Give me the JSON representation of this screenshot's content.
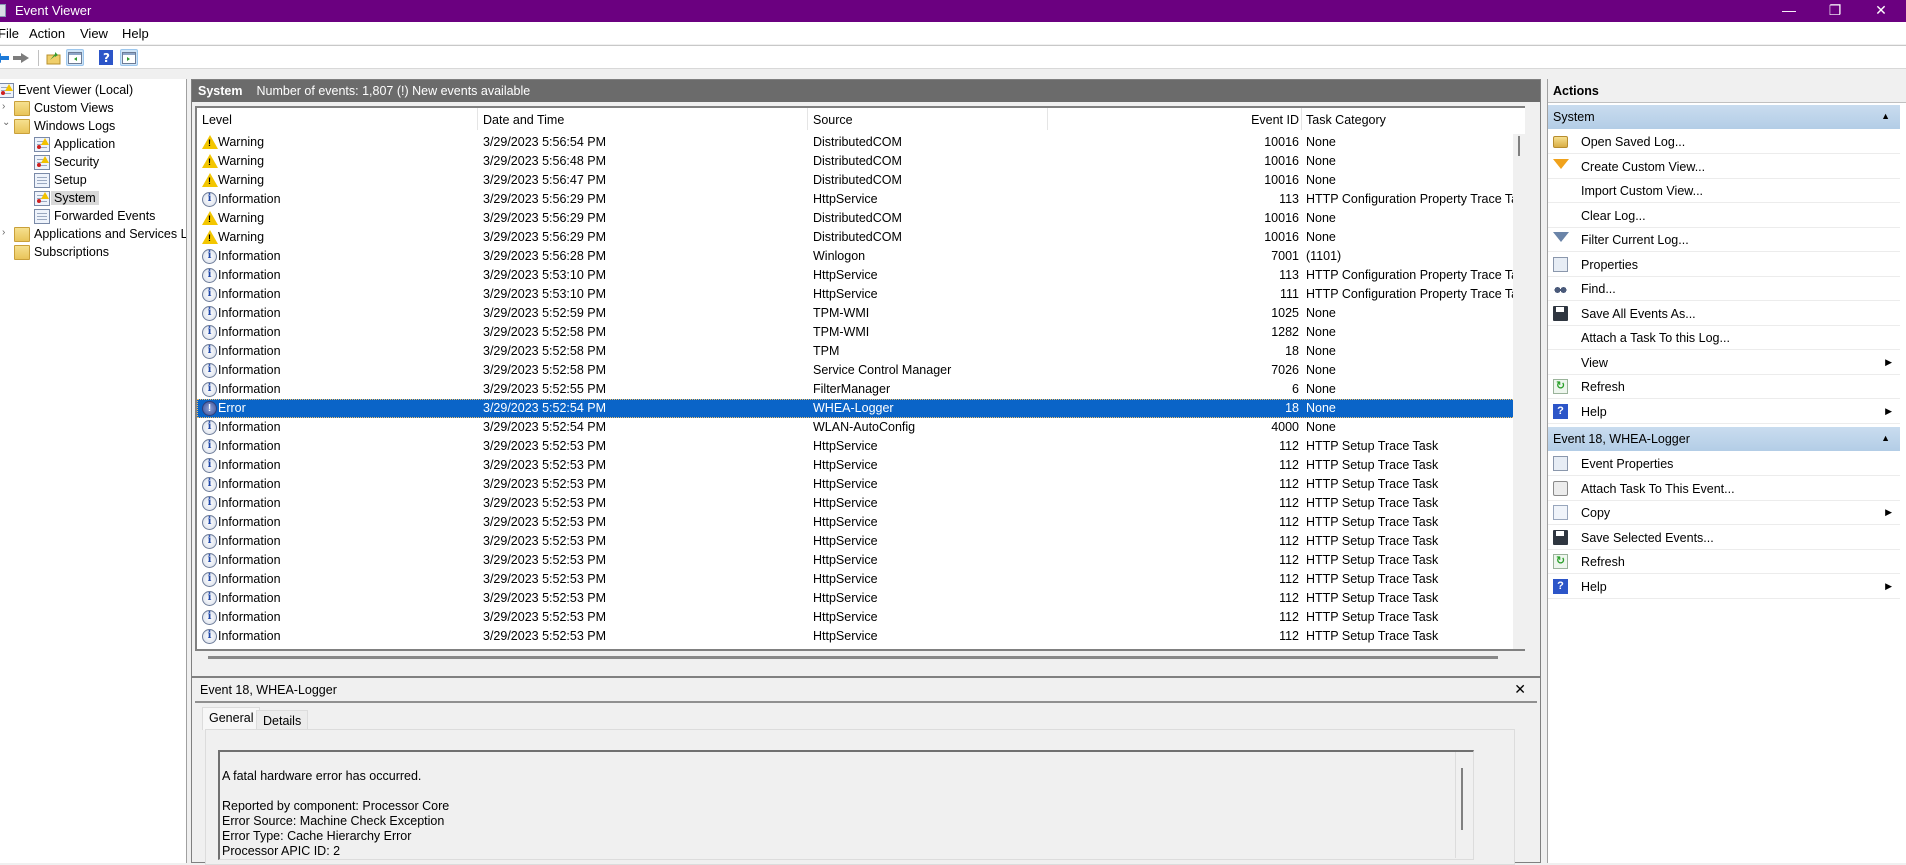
{
  "window": {
    "title": "Event Viewer",
    "controls": {
      "minimize": "—",
      "restore": "❐",
      "close": "✕"
    }
  },
  "menu": [
    "File",
    "Action",
    "View",
    "Help"
  ],
  "toolbar": [
    {
      "icon": "back-arrow-icon"
    },
    {
      "icon": "forward-arrow-icon"
    },
    {
      "icon": "up-folder-icon"
    },
    {
      "icon": "show-hide-console-tree-icon"
    },
    {
      "icon": "help-icon",
      "glyph": "?"
    },
    {
      "icon": "show-hide-action-pane-icon"
    }
  ],
  "tree": {
    "root": "Event Viewer (Local)",
    "items": [
      {
        "label": "Custom Views",
        "level": 1,
        "expander": "›"
      },
      {
        "label": "Windows Logs",
        "level": 1,
        "expander": "⌄"
      },
      {
        "label": "Application",
        "level": 2
      },
      {
        "label": "Security",
        "level": 2
      },
      {
        "label": "Setup",
        "level": 2
      },
      {
        "label": "System",
        "level": 2,
        "selected": true
      },
      {
        "label": "Forwarded Events",
        "level": 2
      },
      {
        "label": "Applications and Services Lo",
        "level": 1,
        "expander": "›"
      },
      {
        "label": "Subscriptions",
        "level": 1
      }
    ]
  },
  "center": {
    "log_name": "System",
    "summary": "Number of events: 1,807 (!) New events available",
    "columns": [
      "Level",
      "Date and Time",
      "Source",
      "Event ID",
      "Task Category"
    ],
    "rows": [
      {
        "level": "Warning",
        "datetime": "3/29/2023 5:56:54 PM",
        "source": "DistributedCOM",
        "event_id": "10016",
        "task": "None"
      },
      {
        "level": "Warning",
        "datetime": "3/29/2023 5:56:48 PM",
        "source": "DistributedCOM",
        "event_id": "10016",
        "task": "None"
      },
      {
        "level": "Warning",
        "datetime": "3/29/2023 5:56:47 PM",
        "source": "DistributedCOM",
        "event_id": "10016",
        "task": "None"
      },
      {
        "level": "Information",
        "datetime": "3/29/2023 5:56:29 PM",
        "source": "HttpService",
        "event_id": "113",
        "task": "HTTP Configuration Property Trace Task"
      },
      {
        "level": "Warning",
        "datetime": "3/29/2023 5:56:29 PM",
        "source": "DistributedCOM",
        "event_id": "10016",
        "task": "None"
      },
      {
        "level": "Warning",
        "datetime": "3/29/2023 5:56:29 PM",
        "source": "DistributedCOM",
        "event_id": "10016",
        "task": "None"
      },
      {
        "level": "Information",
        "datetime": "3/29/2023 5:56:28 PM",
        "source": "Winlogon",
        "event_id": "7001",
        "task": "(1101)"
      },
      {
        "level": "Information",
        "datetime": "3/29/2023 5:53:10 PM",
        "source": "HttpService",
        "event_id": "113",
        "task": "HTTP Configuration Property Trace Task"
      },
      {
        "level": "Information",
        "datetime": "3/29/2023 5:53:10 PM",
        "source": "HttpService",
        "event_id": "111",
        "task": "HTTP Configuration Property Trace Task"
      },
      {
        "level": "Information",
        "datetime": "3/29/2023 5:52:59 PM",
        "source": "TPM-WMI",
        "event_id": "1025",
        "task": "None"
      },
      {
        "level": "Information",
        "datetime": "3/29/2023 5:52:58 PM",
        "source": "TPM-WMI",
        "event_id": "1282",
        "task": "None"
      },
      {
        "level": "Information",
        "datetime": "3/29/2023 5:52:58 PM",
        "source": "TPM",
        "event_id": "18",
        "task": "None"
      },
      {
        "level": "Information",
        "datetime": "3/29/2023 5:52:58 PM",
        "source": "Service Control Manager",
        "event_id": "7026",
        "task": "None"
      },
      {
        "level": "Information",
        "datetime": "3/29/2023 5:52:55 PM",
        "source": "FilterManager",
        "event_id": "6",
        "task": "None"
      },
      {
        "level": "Error",
        "datetime": "3/29/2023 5:52:54 PM",
        "source": "WHEA-Logger",
        "event_id": "18",
        "task": "None",
        "selected": true
      },
      {
        "level": "Information",
        "datetime": "3/29/2023 5:52:54 PM",
        "source": "WLAN-AutoConfig",
        "event_id": "4000",
        "task": "None"
      },
      {
        "level": "Information",
        "datetime": "3/29/2023 5:52:53 PM",
        "source": "HttpService",
        "event_id": "112",
        "task": "HTTP Setup Trace Task"
      },
      {
        "level": "Information",
        "datetime": "3/29/2023 5:52:53 PM",
        "source": "HttpService",
        "event_id": "112",
        "task": "HTTP Setup Trace Task"
      },
      {
        "level": "Information",
        "datetime": "3/29/2023 5:52:53 PM",
        "source": "HttpService",
        "event_id": "112",
        "task": "HTTP Setup Trace Task"
      },
      {
        "level": "Information",
        "datetime": "3/29/2023 5:52:53 PM",
        "source": "HttpService",
        "event_id": "112",
        "task": "HTTP Setup Trace Task"
      },
      {
        "level": "Information",
        "datetime": "3/29/2023 5:52:53 PM",
        "source": "HttpService",
        "event_id": "112",
        "task": "HTTP Setup Trace Task"
      },
      {
        "level": "Information",
        "datetime": "3/29/2023 5:52:53 PM",
        "source": "HttpService",
        "event_id": "112",
        "task": "HTTP Setup Trace Task"
      },
      {
        "level": "Information",
        "datetime": "3/29/2023 5:52:53 PM",
        "source": "HttpService",
        "event_id": "112",
        "task": "HTTP Setup Trace Task"
      },
      {
        "level": "Information",
        "datetime": "3/29/2023 5:52:53 PM",
        "source": "HttpService",
        "event_id": "112",
        "task": "HTTP Setup Trace Task"
      },
      {
        "level": "Information",
        "datetime": "3/29/2023 5:52:53 PM",
        "source": "HttpService",
        "event_id": "112",
        "task": "HTTP Setup Trace Task"
      },
      {
        "level": "Information",
        "datetime": "3/29/2023 5:52:53 PM",
        "source": "HttpService",
        "event_id": "112",
        "task": "HTTP Setup Trace Task"
      },
      {
        "level": "Information",
        "datetime": "3/29/2023 5:52:53 PM",
        "source": "HttpService",
        "event_id": "112",
        "task": "HTTP Setup Trace Task"
      }
    ]
  },
  "detail": {
    "title": "Event 18, WHEA-Logger",
    "close": "✕",
    "tabs": [
      "General",
      "Details"
    ],
    "active_tab": "General",
    "message": "A fatal hardware error has occurred.\n\nReported by component: Processor Core\nError Source: Machine Check Exception\nError Type: Cache Hierarchy Error\nProcessor APIC ID: 2"
  },
  "actions": {
    "title": "Actions",
    "sections": [
      {
        "header": "System",
        "items": [
          {
            "label": "Open Saved Log...",
            "icon": "open-folder-icon"
          },
          {
            "label": "Create Custom View...",
            "icon": "funnel-icon"
          },
          {
            "label": "Import Custom View...",
            "icon": ""
          },
          {
            "label": "Clear Log...",
            "icon": ""
          },
          {
            "label": "Filter Current Log...",
            "icon": "filter-icon"
          },
          {
            "label": "Properties",
            "icon": "properties-icon"
          },
          {
            "label": "Find...",
            "icon": "binoculars-icon"
          },
          {
            "label": "Save All Events As...",
            "icon": "save-icon"
          },
          {
            "label": "Attach a Task To this Log...",
            "icon": ""
          },
          {
            "label": "View",
            "icon": "",
            "submenu": true
          },
          {
            "label": "Refresh",
            "icon": "refresh-icon"
          },
          {
            "label": "Help",
            "icon": "help-icon",
            "submenu": true
          }
        ]
      },
      {
        "header": "Event 18, WHEA-Logger",
        "items": [
          {
            "label": "Event Properties",
            "icon": "properties-icon"
          },
          {
            "label": "Attach Task To This Event...",
            "icon": "task-clock-icon"
          },
          {
            "label": "Copy",
            "icon": "copy-icon",
            "submenu": true
          },
          {
            "label": "Save Selected Events...",
            "icon": "save-icon"
          },
          {
            "label": "Refresh",
            "icon": "refresh-icon"
          },
          {
            "label": "Help",
            "icon": "help-icon",
            "submenu": true
          }
        ]
      }
    ]
  },
  "colors": {
    "titlebar": "#6b0080",
    "selection": "#0a64c8",
    "section_header": "#bcd3ea",
    "panel_header": "#6b6b6b"
  }
}
